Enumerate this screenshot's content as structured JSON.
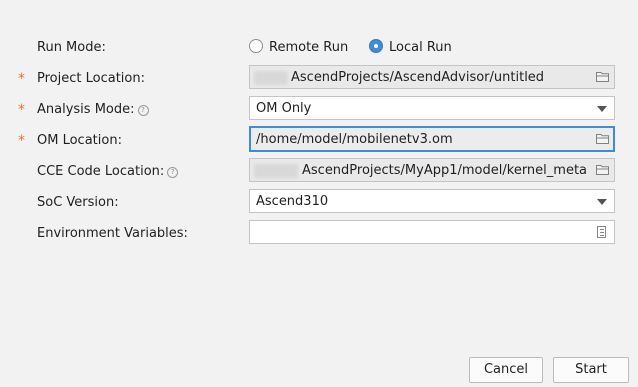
{
  "run_mode": {
    "label": "Run Mode:",
    "options": [
      {
        "label": "Remote Run",
        "selected": false
      },
      {
        "label": "Local Run",
        "selected": true
      }
    ]
  },
  "project_location": {
    "label": "Project Location:",
    "required": "*",
    "value": "AscendProjects/AscendAdvisor/untitled",
    "icon": "folder-icon"
  },
  "analysis_mode": {
    "label": "Analysis Mode:",
    "required": "*",
    "help": "?",
    "value": "OM Only",
    "icon": "chevron-down-icon"
  },
  "om_location": {
    "label": "OM Location:",
    "required": "*",
    "value": "/home/model/mobilenetv3.om",
    "icon": "folder-icon"
  },
  "cce_code_location": {
    "label": "CCE Code Location:",
    "help": "?",
    "value": "AscendProjects/MyApp1/model/kernel_meta",
    "icon": "folder-icon"
  },
  "soc_version": {
    "label": "SoC Version:",
    "value": "Ascend310",
    "icon": "chevron-down-icon"
  },
  "environment_variables": {
    "label": "Environment Variables:",
    "value": "",
    "icon": "document-icon"
  },
  "buttons": {
    "cancel": "Cancel",
    "start": "Start"
  },
  "colors": {
    "accent": "#3f8dd5",
    "required": "#e8772e",
    "background": "#f2f2f2"
  }
}
